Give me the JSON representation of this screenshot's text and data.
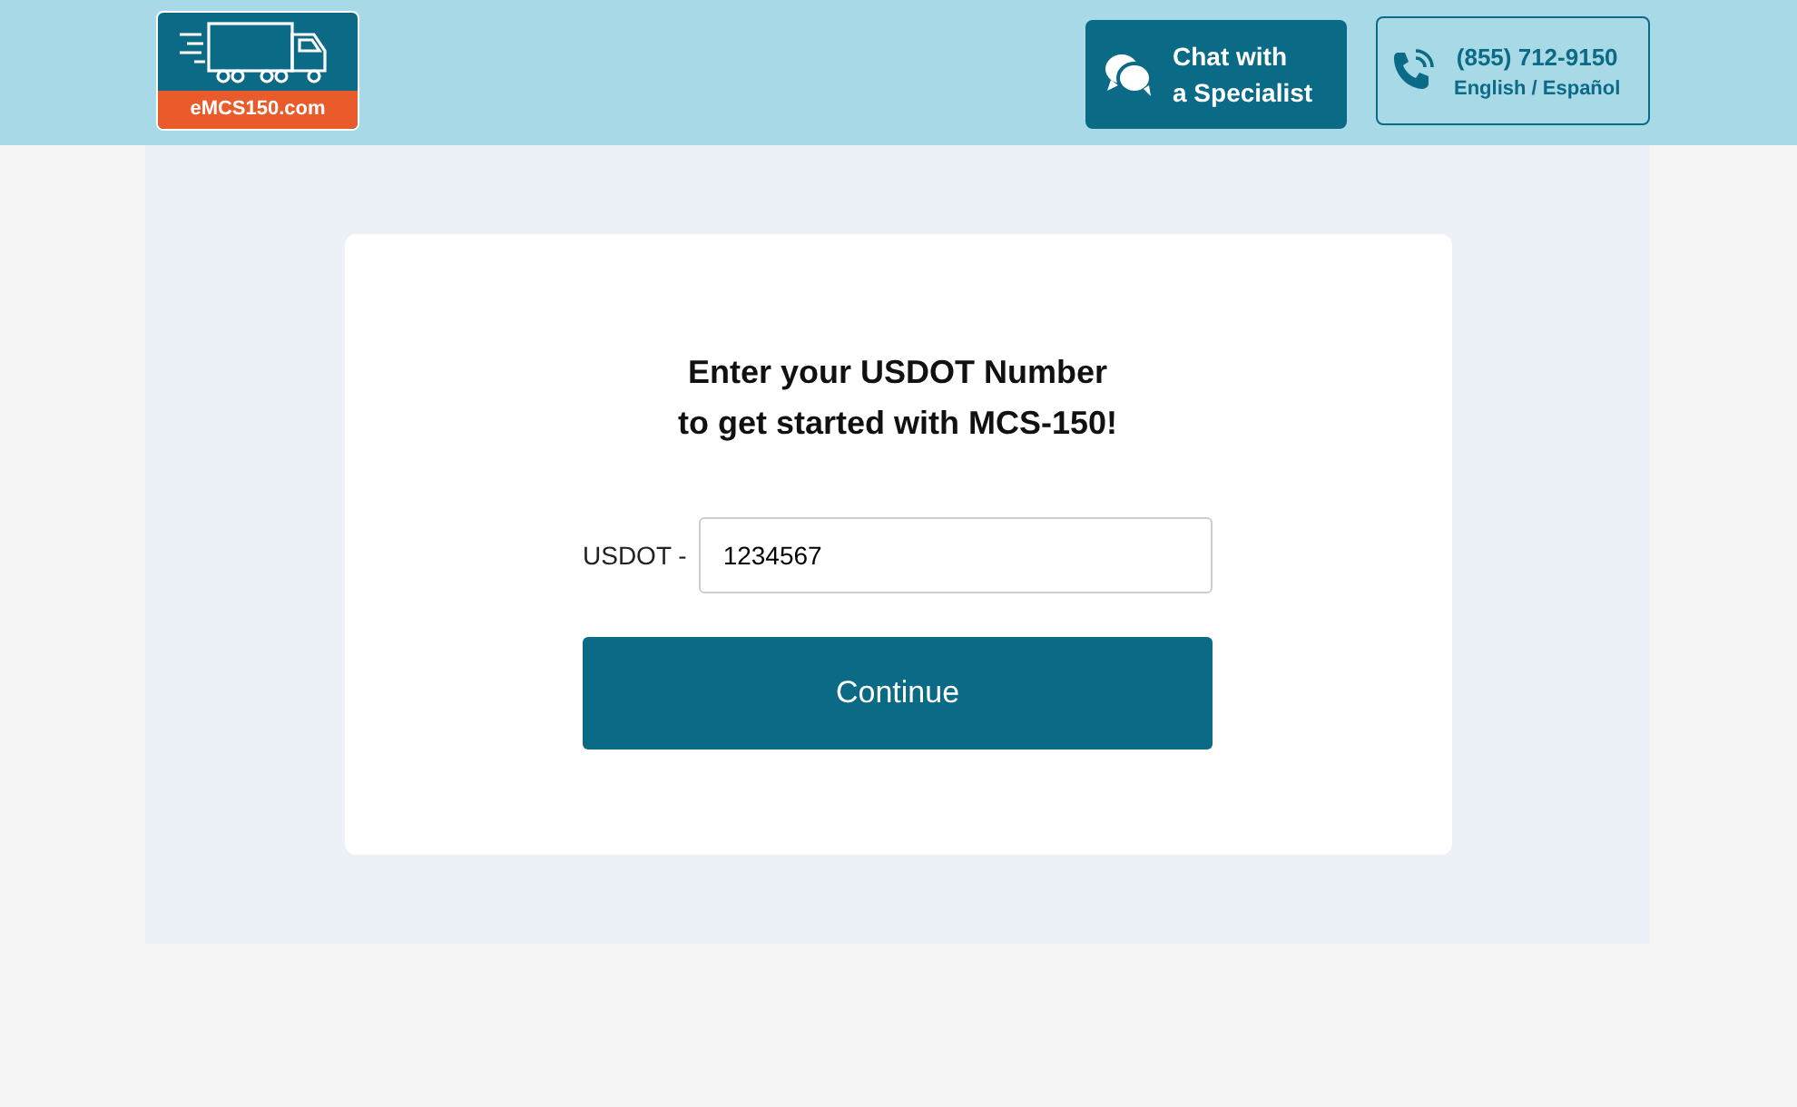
{
  "logo": {
    "text": "eMCS150.com"
  },
  "chat_button": {
    "lines": [
      "Chat with",
      "a Specialist"
    ]
  },
  "phone": {
    "number": "(855) 712-9150",
    "languages": "English / Español"
  },
  "form": {
    "heading": [
      "Enter your USDOT Number",
      "to get started with MCS-150!"
    ],
    "field_label": "USDOT -",
    "field_value": "1234567",
    "button": "Continue"
  }
}
